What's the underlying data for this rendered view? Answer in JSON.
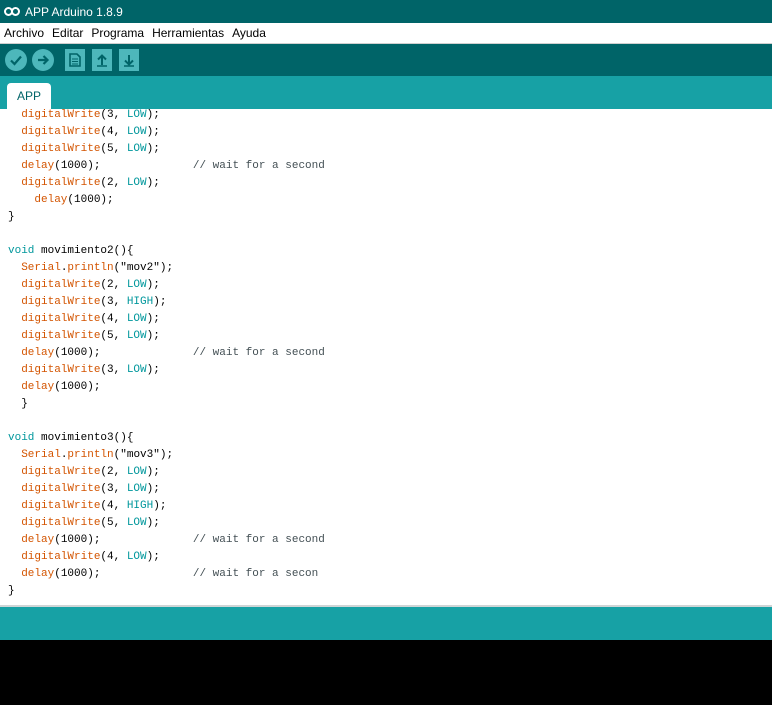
{
  "window": {
    "title": "APP Arduino 1.8.9"
  },
  "menu": [
    "Archivo",
    "Editar",
    "Programa",
    "Herramientas",
    "Ayuda"
  ],
  "toolbar": {
    "buttons": [
      {
        "name": "verify",
        "icon": "check-icon"
      },
      {
        "name": "upload",
        "icon": "arrow-right-icon"
      },
      {
        "name": "new",
        "icon": "new-file-icon"
      },
      {
        "name": "open",
        "icon": "arrow-up-icon"
      },
      {
        "name": "save",
        "icon": "arrow-down-icon"
      }
    ]
  },
  "tabs": [
    {
      "label": "APP"
    }
  ],
  "code_lines": [
    [
      [
        "  ",
        ""
      ],
      [
        "digitalWrite",
        "fn"
      ],
      [
        "(3, ",
        ""
      ],
      [
        "LOW",
        "kw"
      ],
      [
        ");",
        ""
      ]
    ],
    [
      [
        "  ",
        ""
      ],
      [
        "digitalWrite",
        "fn"
      ],
      [
        "(4, ",
        ""
      ],
      [
        "LOW",
        "kw"
      ],
      [
        ");",
        ""
      ]
    ],
    [
      [
        "  ",
        ""
      ],
      [
        "digitalWrite",
        "fn"
      ],
      [
        "(5, ",
        ""
      ],
      [
        "LOW",
        "kw"
      ],
      [
        ");",
        ""
      ]
    ],
    [
      [
        "  ",
        ""
      ],
      [
        "delay",
        "fn"
      ],
      [
        "(1000);              ",
        ""
      ],
      [
        "// wait for a second",
        "cm"
      ]
    ],
    [
      [
        "  ",
        ""
      ],
      [
        "digitalWrite",
        "fn"
      ],
      [
        "(2, ",
        ""
      ],
      [
        "LOW",
        "kw"
      ],
      [
        ");",
        ""
      ]
    ],
    [
      [
        "    ",
        ""
      ],
      [
        "delay",
        "fn"
      ],
      [
        "(1000);",
        ""
      ]
    ],
    [
      [
        "}",
        ""
      ]
    ],
    [
      [
        "",
        ""
      ]
    ],
    [
      [
        "void",
        "kw"
      ],
      [
        " movimiento2(){",
        ""
      ]
    ],
    [
      [
        "  ",
        ""
      ],
      [
        "Serial",
        "fn"
      ],
      [
        ".",
        ""
      ],
      [
        "println",
        "fn"
      ],
      [
        "(\"mov2\");",
        ""
      ]
    ],
    [
      [
        "  ",
        ""
      ],
      [
        "digitalWrite",
        "fn"
      ],
      [
        "(2, ",
        ""
      ],
      [
        "LOW",
        "kw"
      ],
      [
        ");",
        ""
      ]
    ],
    [
      [
        "  ",
        ""
      ],
      [
        "digitalWrite",
        "fn"
      ],
      [
        "(3, ",
        ""
      ],
      [
        "HIGH",
        "kw"
      ],
      [
        ");",
        ""
      ]
    ],
    [
      [
        "  ",
        ""
      ],
      [
        "digitalWrite",
        "fn"
      ],
      [
        "(4, ",
        ""
      ],
      [
        "LOW",
        "kw"
      ],
      [
        ");",
        ""
      ]
    ],
    [
      [
        "  ",
        ""
      ],
      [
        "digitalWrite",
        "fn"
      ],
      [
        "(5, ",
        ""
      ],
      [
        "LOW",
        "kw"
      ],
      [
        ");",
        ""
      ]
    ],
    [
      [
        "  ",
        ""
      ],
      [
        "delay",
        "fn"
      ],
      [
        "(1000);              ",
        ""
      ],
      [
        "// wait for a second",
        "cm"
      ]
    ],
    [
      [
        "  ",
        ""
      ],
      [
        "digitalWrite",
        "fn"
      ],
      [
        "(3, ",
        ""
      ],
      [
        "LOW",
        "kw"
      ],
      [
        ");",
        ""
      ]
    ],
    [
      [
        "  ",
        ""
      ],
      [
        "delay",
        "fn"
      ],
      [
        "(1000);",
        ""
      ]
    ],
    [
      [
        "  }",
        ""
      ]
    ],
    [
      [
        "",
        ""
      ]
    ],
    [
      [
        "void",
        "kw"
      ],
      [
        " movimiento3(){",
        ""
      ]
    ],
    [
      [
        "  ",
        ""
      ],
      [
        "Serial",
        "fn"
      ],
      [
        ".",
        ""
      ],
      [
        "println",
        "fn"
      ],
      [
        "(\"mov3\");",
        ""
      ]
    ],
    [
      [
        "  ",
        ""
      ],
      [
        "digitalWrite",
        "fn"
      ],
      [
        "(2, ",
        ""
      ],
      [
        "LOW",
        "kw"
      ],
      [
        ");",
        ""
      ]
    ],
    [
      [
        "  ",
        ""
      ],
      [
        "digitalWrite",
        "fn"
      ],
      [
        "(3, ",
        ""
      ],
      [
        "LOW",
        "kw"
      ],
      [
        ");",
        ""
      ]
    ],
    [
      [
        "  ",
        ""
      ],
      [
        "digitalWrite",
        "fn"
      ],
      [
        "(4, ",
        ""
      ],
      [
        "HIGH",
        "kw"
      ],
      [
        ");",
        ""
      ]
    ],
    [
      [
        "  ",
        ""
      ],
      [
        "digitalWrite",
        "fn"
      ],
      [
        "(5, ",
        ""
      ],
      [
        "LOW",
        "kw"
      ],
      [
        ");",
        ""
      ]
    ],
    [
      [
        "  ",
        ""
      ],
      [
        "delay",
        "fn"
      ],
      [
        "(1000);              ",
        ""
      ],
      [
        "// wait for a second",
        "cm"
      ]
    ],
    [
      [
        "  ",
        ""
      ],
      [
        "digitalWrite",
        "fn"
      ],
      [
        "(4, ",
        ""
      ],
      [
        "LOW",
        "kw"
      ],
      [
        ");",
        ""
      ]
    ],
    [
      [
        "  ",
        ""
      ],
      [
        "delay",
        "fn"
      ],
      [
        "(1000);              ",
        ""
      ],
      [
        "// wait for a secon",
        "cm"
      ]
    ],
    [
      [
        "}",
        ""
      ]
    ]
  ],
  "colors": {
    "title_bar": "#006468",
    "toolbar": "#006468",
    "tab_bar": "#17a1a5",
    "button": "#4db7bb",
    "keyword": "#00979c",
    "function": "#d35400",
    "comment": "#434f54",
    "console": "#000000"
  }
}
